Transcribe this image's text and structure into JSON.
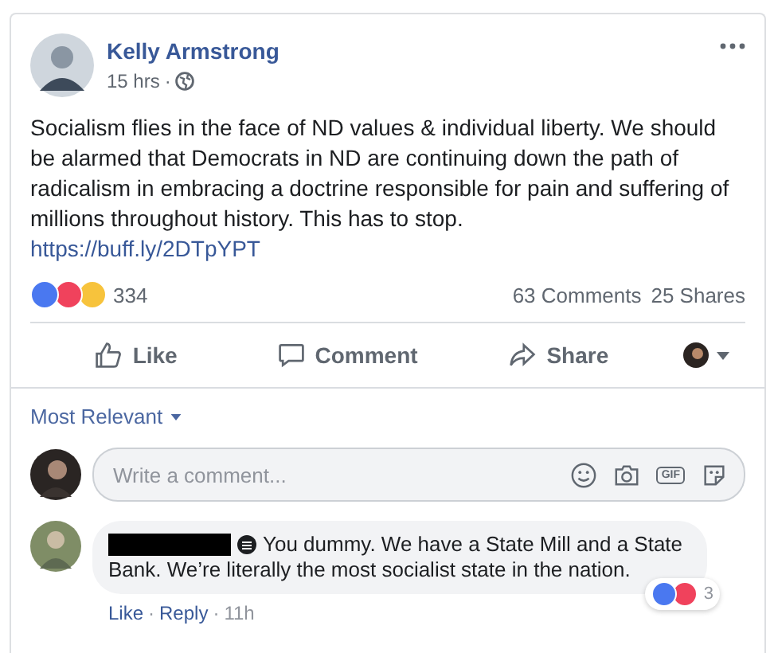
{
  "post": {
    "author": "Kelly Armstrong",
    "time": "15 hrs",
    "separator": "·",
    "text": "Socialism flies in the face of ND values & individual liberty. We should be alarmed that Democrats in ND are continuing down the path of radicalism in embracing a doctrine responsible for pain and suffering of millions throughout history. This has to stop.",
    "link": "https://buff.ly/2DTpYPT",
    "reactions": [
      {
        "kind": "like"
      },
      {
        "kind": "love"
      },
      {
        "kind": "haha"
      }
    ],
    "reaction_count": "334",
    "comments": "63 Comments",
    "shares": "25 Shares"
  },
  "actions": [
    {
      "kind": "like",
      "label": "Like"
    },
    {
      "kind": "comment",
      "label": "Comment"
    },
    {
      "kind": "share",
      "label": "Share"
    }
  ],
  "sort": "Most Relevant",
  "composer": {
    "placeholder": "Write a comment...",
    "gif_label": "GIF"
  },
  "comment": {
    "author_redacted": true,
    "text_lines": [
      "You dummy. We have a State Mill and a State",
      "Bank. We’re literally the most socialist state in the nation."
    ],
    "reactions": [
      {
        "kind": "like"
      },
      {
        "kind": "love"
      }
    ],
    "reaction_count": "3",
    "links": [
      "Like",
      "Reply"
    ],
    "separator": "·",
    "time": "11h"
  }
}
